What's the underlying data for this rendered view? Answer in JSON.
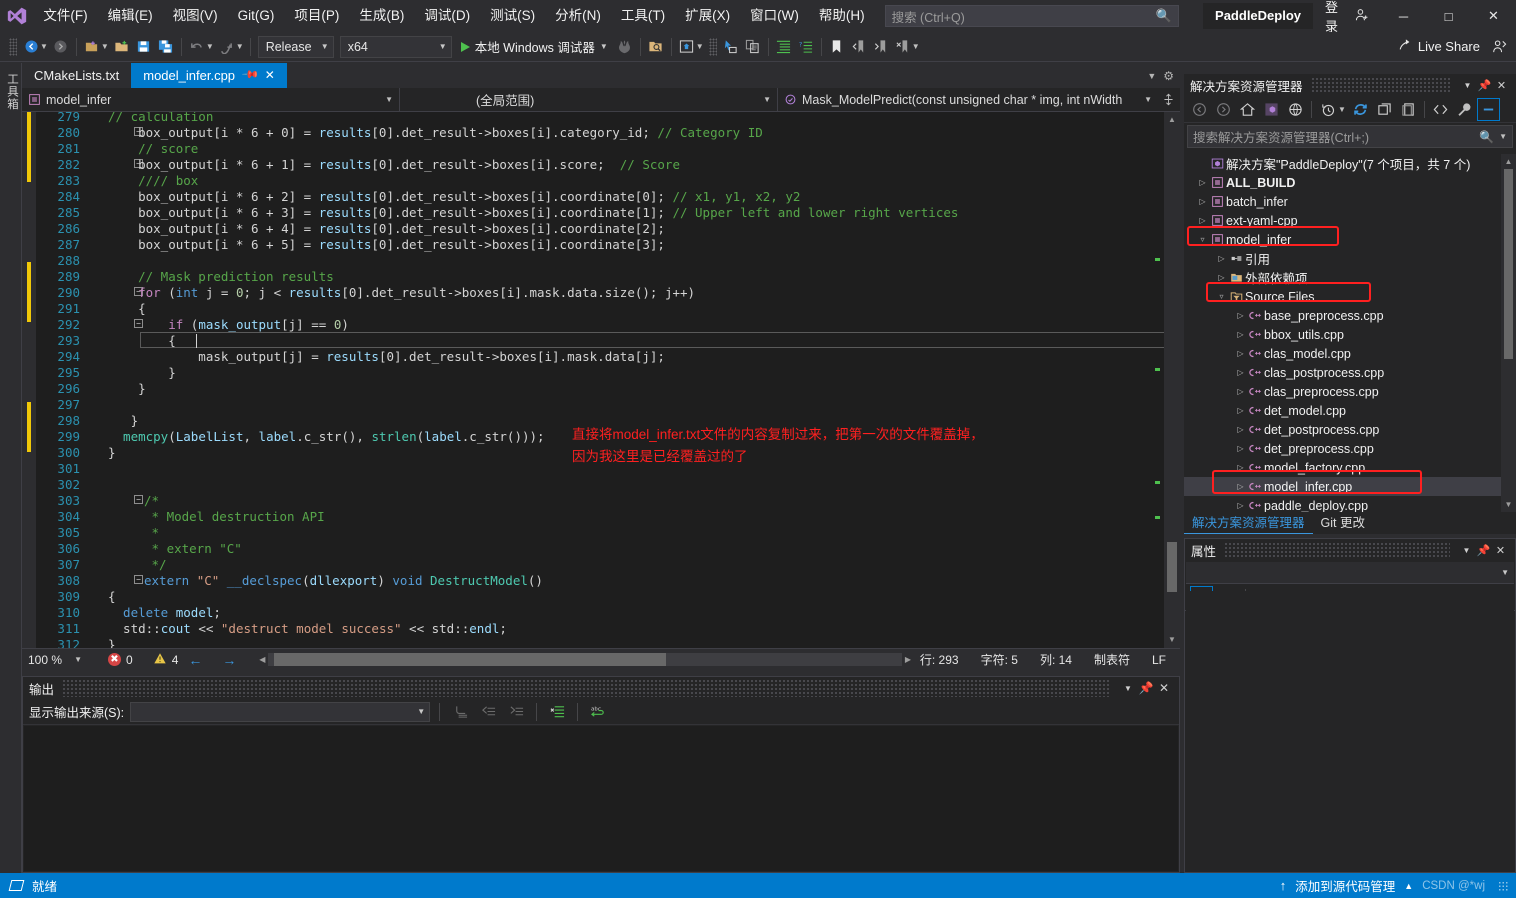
{
  "titlebar": {
    "menus": [
      "文件(F)",
      "编辑(E)",
      "视图(V)",
      "Git(G)",
      "项目(P)",
      "生成(B)",
      "调试(D)",
      "测试(S)",
      "分析(N)",
      "工具(T)",
      "扩展(X)",
      "窗口(W)",
      "帮助(H)"
    ],
    "search_placeholder": "搜索 (Ctrl+Q)",
    "project_name": "PaddleDeploy",
    "signin_label": "登录",
    "minimize": "─",
    "maximize": "□",
    "close": "✕"
  },
  "toolbar": {
    "config": "Release",
    "platform": "x64",
    "run_label": "本地 Windows 调试器",
    "live_share": "Live Share"
  },
  "toolbox": {
    "label": "工具箱"
  },
  "tabs": [
    {
      "label": "CMakeLists.txt",
      "active": false
    },
    {
      "label": "model_infer.cpp",
      "active": true
    }
  ],
  "navbar": {
    "project": "model_infer",
    "scope": "(全局范围)",
    "member": "Mask_ModelPredict(const unsigned char * img, int nWidth"
  },
  "editor": {
    "first_line": 280,
    "lines": [
      {
        "n": 279,
        "text": "",
        "partial": true
      },
      {
        "n": 280,
        "text": "box_output[i * 6 + 0] = results[0].det_result->boxes[i].category_id; // Category ID",
        "indent": 3,
        "glyph": "minus"
      },
      {
        "n": 281,
        "text": "// score",
        "indent": 3,
        "comment": true
      },
      {
        "n": 282,
        "text": "box_output[i * 6 + 1] = results[0].det_result->boxes[i].score;  // Score",
        "indent": 3,
        "glyph": "minus"
      },
      {
        "n": 283,
        "text": "//// box",
        "indent": 3,
        "comment": true
      },
      {
        "n": 284,
        "text": "box_output[i * 6 + 2] = results[0].det_result->boxes[i].coordinate[0]; // x1, y1, x2, y2",
        "indent": 3
      },
      {
        "n": 285,
        "text": "box_output[i * 6 + 3] = results[0].det_result->boxes[i].coordinate[1]; // Upper left and lower right vertices",
        "indent": 3
      },
      {
        "n": 286,
        "text": "box_output[i * 6 + 4] = results[0].det_result->boxes[i].coordinate[2];",
        "indent": 3
      },
      {
        "n": 287,
        "text": "box_output[i * 6 + 5] = results[0].det_result->boxes[i].coordinate[3];",
        "indent": 3
      },
      {
        "n": 288,
        "text": ""
      },
      {
        "n": 289,
        "text": "// Mask prediction results",
        "indent": 3,
        "comment": true
      },
      {
        "n": 290,
        "text": "for (int j = 0; j < results[0].det_result->boxes[i].mask.data.size(); j++)",
        "indent": 3,
        "glyph": "minus"
      },
      {
        "n": 291,
        "text": "{",
        "indent": 3
      },
      {
        "n": 292,
        "text": "if (mask_output[j] == 0)",
        "indent": 4,
        "glyph": "minus"
      },
      {
        "n": 293,
        "text": "{",
        "indent": 4,
        "current": true
      },
      {
        "n": 294,
        "text": "mask_output[j] = results[0].det_result->boxes[i].mask.data[j];",
        "indent": 5
      },
      {
        "n": 295,
        "text": "}",
        "indent": 4
      },
      {
        "n": 296,
        "text": "}",
        "indent": 3
      },
      {
        "n": 297,
        "text": ""
      },
      {
        "n": 298,
        "text": "}",
        "indent": 2
      },
      {
        "n": 299,
        "text": "memcpy(LabelList, label.c_str(), strlen(label.c_str()));",
        "indent": 2
      },
      {
        "n": 300,
        "text": "}",
        "indent": 1
      },
      {
        "n": 301,
        "text": ""
      },
      {
        "n": 302,
        "text": ""
      },
      {
        "n": 303,
        "text": "/*",
        "indent": 1,
        "comment": true,
        "glyph": "minus"
      },
      {
        "n": 304,
        "text": " * Model destruction API",
        "indent": 1,
        "comment": true
      },
      {
        "n": 305,
        "text": " *",
        "indent": 1,
        "comment": true
      },
      {
        "n": 306,
        "text": " * extern \"C\"",
        "indent": 1,
        "comment": true
      },
      {
        "n": 307,
        "text": " */",
        "indent": 1,
        "comment": true
      },
      {
        "n": 308,
        "text": "extern \"C\" __declspec(dllexport) void DestructModel()",
        "indent": 1,
        "glyph": "minus"
      },
      {
        "n": 309,
        "text": "{",
        "indent": 1
      },
      {
        "n": 310,
        "text": "delete model;",
        "indent": 2
      },
      {
        "n": 311,
        "text": "std::cout << \"destruct model success\" << std::endl;",
        "indent": 2
      },
      {
        "n": 312,
        "text": "}",
        "indent": 1
      }
    ],
    "annotation": [
      "直接将model_infer.txt文件的内容复制过来，把第一次的文件覆盖掉，",
      "因为我这里是已经覆盖过的了"
    ],
    "annotation_color": "#ff2020"
  },
  "editor_status": {
    "zoom": "100 %",
    "errors": "0",
    "warnings": "4",
    "line_label": "行: 293",
    "char_label": "字符: 5",
    "col_label": "列: 14",
    "tab_label": "制表符",
    "eol_label": "LF"
  },
  "output": {
    "title": "输出",
    "source_label": "显示输出来源(S):",
    "source_value": "",
    "body_text": ""
  },
  "solution_explorer": {
    "title": "解决方案资源管理器",
    "search_placeholder": "搜索解决方案资源管理器(Ctrl+;)",
    "tree": [
      {
        "depth": 0,
        "label": "解决方案\"PaddleDeploy\"(7 个项目，共 7 个)",
        "icon": "solution-icon",
        "expander": "none"
      },
      {
        "depth": 1,
        "label": "ALL_BUILD",
        "icon": "project-icon",
        "expander": "collapsed",
        "bold": true
      },
      {
        "depth": 1,
        "label": "batch_infer",
        "icon": "project-icon",
        "expander": "collapsed"
      },
      {
        "depth": 1,
        "label": "ext-yaml-cpp",
        "icon": "project-icon",
        "expander": "collapsed"
      },
      {
        "depth": 1,
        "label": "model_infer",
        "icon": "project-icon",
        "expander": "expanded",
        "highlight": true
      },
      {
        "depth": 2,
        "label": "引用",
        "icon": "references-icon",
        "expander": "collapsed"
      },
      {
        "depth": 2,
        "label": "外部依赖项",
        "icon": "folder-icon",
        "expander": "collapsed"
      },
      {
        "depth": 2,
        "label": "Source Files",
        "icon": "filter-folder-icon",
        "expander": "expanded",
        "highlight": true
      },
      {
        "depth": 3,
        "label": "base_preprocess.cpp",
        "icon": "cpp-icon",
        "expander": "collapsed"
      },
      {
        "depth": 3,
        "label": "bbox_utils.cpp",
        "icon": "cpp-icon",
        "expander": "collapsed"
      },
      {
        "depth": 3,
        "label": "clas_model.cpp",
        "icon": "cpp-icon",
        "expander": "collapsed"
      },
      {
        "depth": 3,
        "label": "clas_postprocess.cpp",
        "icon": "cpp-icon",
        "expander": "collapsed"
      },
      {
        "depth": 3,
        "label": "clas_preprocess.cpp",
        "icon": "cpp-icon",
        "expander": "collapsed"
      },
      {
        "depth": 3,
        "label": "det_model.cpp",
        "icon": "cpp-icon",
        "expander": "collapsed"
      },
      {
        "depth": 3,
        "label": "det_postprocess.cpp",
        "icon": "cpp-icon",
        "expander": "collapsed"
      },
      {
        "depth": 3,
        "label": "det_preprocess.cpp",
        "icon": "cpp-icon",
        "expander": "collapsed"
      },
      {
        "depth": 3,
        "label": "model_factory.cpp",
        "icon": "cpp-icon",
        "expander": "collapsed"
      },
      {
        "depth": 3,
        "label": "model_infer.cpp",
        "icon": "cpp-icon",
        "expander": "collapsed",
        "selected": true,
        "highlight": true
      },
      {
        "depth": 3,
        "label": "paddle_deploy.cpp",
        "icon": "cpp-icon",
        "expander": "collapsed"
      }
    ],
    "bottom_tabs": [
      {
        "label": "解决方案资源管理器",
        "active": true
      },
      {
        "label": "Git 更改",
        "active": false
      }
    ]
  },
  "properties": {
    "title": "属性",
    "selected_object": ""
  },
  "statusbar": {
    "ready": "就绪",
    "source_control": "添加到源代码管理",
    "watermark": "CSDN @*wj"
  },
  "colors": {
    "accent": "#007acc",
    "annotation_red": "#ff2020",
    "highlight_red": "#ff2020",
    "editor_bg": "#1e1e1e",
    "chrome_bg": "#2d2d30"
  }
}
